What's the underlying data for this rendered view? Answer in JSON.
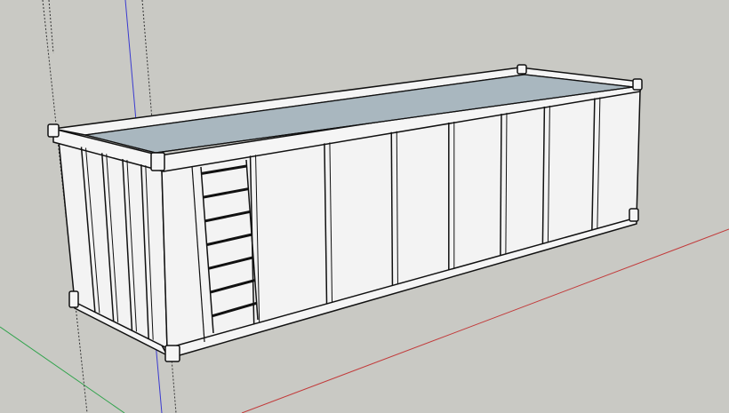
{
  "viewport": {
    "background_color": "#c9c9c4",
    "axis_colors": {
      "red": "#c23a3a",
      "green": "#2fa34b",
      "blue": "#3a3ad0"
    },
    "guide_color": "#333333"
  },
  "model": {
    "description_icon": "container-3d-model",
    "face_colors": {
      "side": "#f3f3f3",
      "rim": "#f5f5f5",
      "interior_floor": "#a9b7bf",
      "edge": "#111111"
    },
    "side_panel_count": 8,
    "end_panel_count": 4,
    "ladder_rungs": 7
  }
}
